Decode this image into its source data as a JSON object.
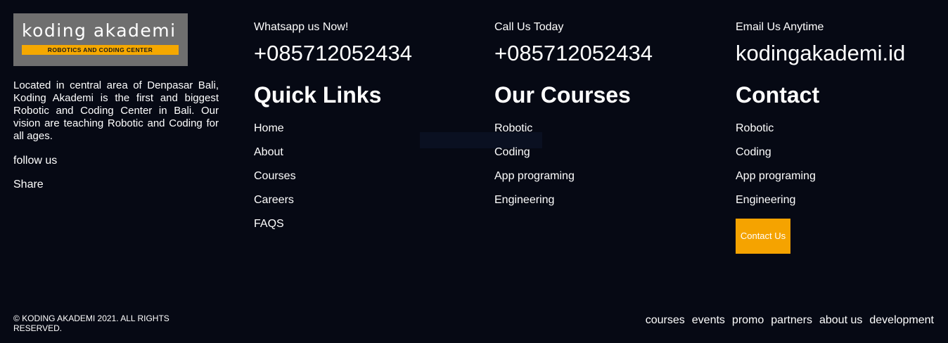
{
  "brand": {
    "logo_name": "koding akademi",
    "logo_tagline": "ROBOTICS AND CODING CENTER",
    "description": "Located in central area of Denpasar Bali, Koding Akademi is the first and biggest Robotic and Coding Center in Bali. Our vision are teaching Robotic and Coding for all ages.",
    "follow_label": "follow us",
    "share_label": "Share"
  },
  "whatsapp": {
    "label": "Whatsapp us Now!",
    "value": "+085712052434"
  },
  "call": {
    "label": "Call Us Today",
    "value": "+085712052434"
  },
  "email": {
    "label": "Email Us Anytime",
    "value": "kodingakademi.id"
  },
  "quick_links": {
    "heading": "Quick Links",
    "items": [
      "Home",
      "About",
      "Courses",
      "Careers",
      "FAQS"
    ]
  },
  "our_courses": {
    "heading": "Our Courses",
    "items": [
      "Robotic",
      "Coding",
      "App programing",
      "Engineering"
    ]
  },
  "contact": {
    "heading": "Contact",
    "items": [
      "Robotic",
      "Coding",
      "App programing",
      "Engineering"
    ],
    "button_label": "Contact Us"
  },
  "footer": {
    "copyright": "© KODING AKADEMI 2021. ALL RIGHTS RESERVED.",
    "nav": [
      "courses",
      "events",
      "promo",
      "partners",
      "about us",
      "development"
    ]
  },
  "colors": {
    "background": "#060914",
    "accent": "#f5a300",
    "logo_bg": "#6f6f6f"
  }
}
